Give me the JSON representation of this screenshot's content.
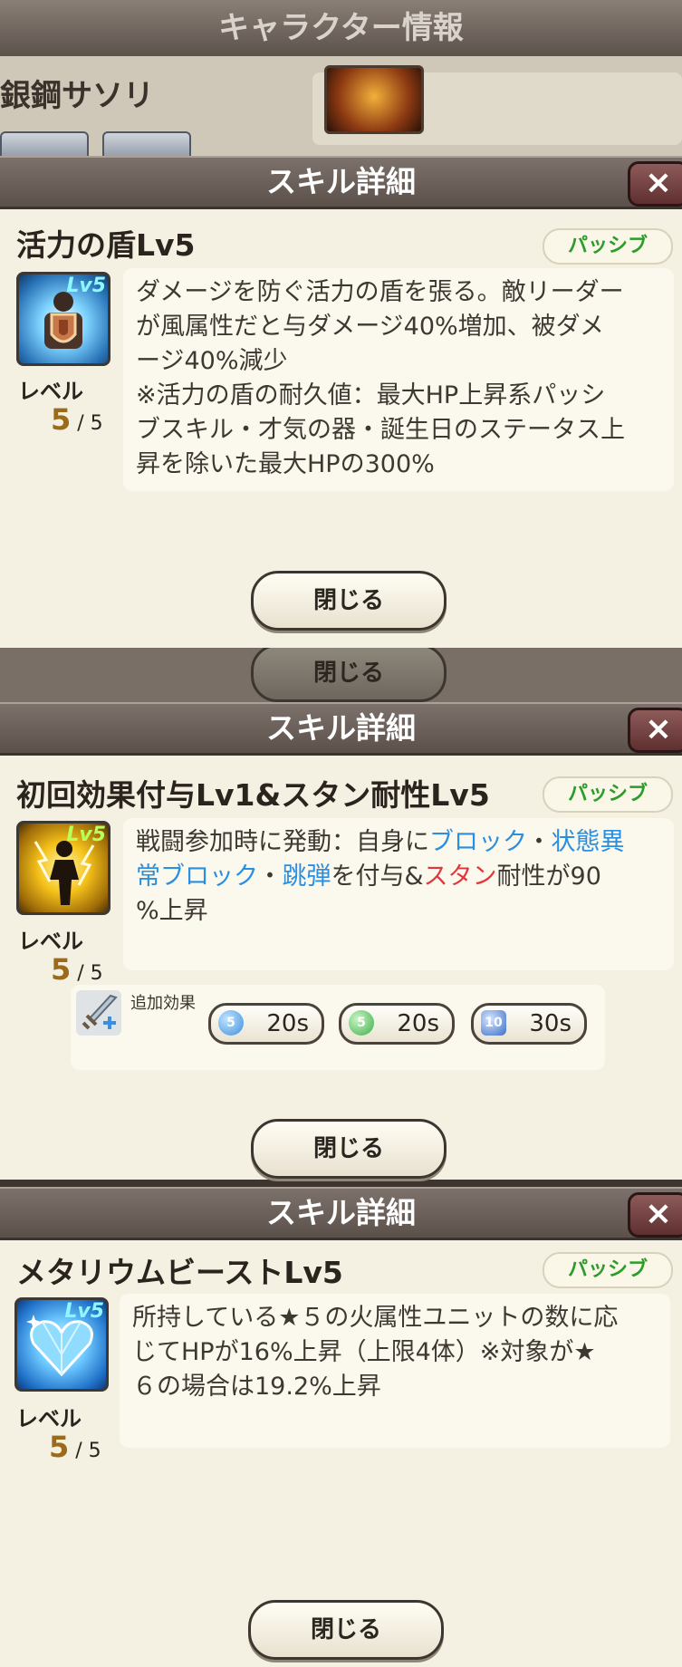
{
  "background": {
    "screen_title": "キャラクター情報",
    "character_name": "銀鋼サソリ",
    "faded_close_label": "閉じる"
  },
  "dialogs": [
    {
      "header": "スキル詳細",
      "close_icon": "×",
      "skill_name": "活力の盾Lv5",
      "type_badge": "パッシブ",
      "icon_badge": "Lv5",
      "level_label": "レベル",
      "level_current": "5",
      "level_max": "/ 5",
      "description": [
        "ダメージを防ぐ活力の盾を張る。敵リーダー",
        "が風属性だと与ダメージ40%増加、被ダメ",
        "ージ40%減少",
        "※活力の盾の耐久値：最大HP上昇系パッシ",
        "ブスキル・才気の器・誕生日のステータス上",
        "昇を除いた最大HPの300%"
      ],
      "close_label": "閉じる"
    },
    {
      "header": "スキル詳細",
      "close_icon": "×",
      "skill_name": "初回効果付与Lv1&スタン耐性Lv5",
      "type_badge": "パッシブ",
      "icon_badge": "Lv5",
      "level_label": "レベル",
      "level_current": "5",
      "level_max": "/ 5",
      "description_parts": {
        "p1": "戦闘参加時に発動：自身に",
        "block": "ブロック",
        "dot1": "・",
        "status_block_1": "状態異",
        "status_block_2": "常ブロック",
        "dot2": "・",
        "ricochet": "跳弾",
        "p2": "を付与&",
        "stun": "スタン",
        "p3": "耐性が90",
        "p4": "%上昇"
      },
      "extra_effects": {
        "label": "追加効果",
        "chips": [
          {
            "icon": "block-orb",
            "badge": "5",
            "duration": "20s",
            "color": "#3f8fe0"
          },
          {
            "icon": "status-block-orb",
            "badge": "5",
            "duration": "20s",
            "color": "#3cae4a"
          },
          {
            "icon": "ricochet-icon",
            "badge": "10",
            "duration": "30s",
            "color": "#3d6fc8"
          }
        ]
      },
      "close_label": "閉じる"
    },
    {
      "header": "スキル詳細",
      "close_icon": "×",
      "skill_name": "メタリウムビーストLv5",
      "type_badge": "パッシブ",
      "icon_badge": "Lv5",
      "level_label": "レベル",
      "level_current": "5",
      "level_max": "/ 5",
      "description": [
        "所持している★５の火属性ユニットの数に応",
        "じてHPが16%上昇（上限4体）※対象が★",
        "６の場合は19.2%上昇"
      ],
      "close_label": "閉じる"
    }
  ]
}
